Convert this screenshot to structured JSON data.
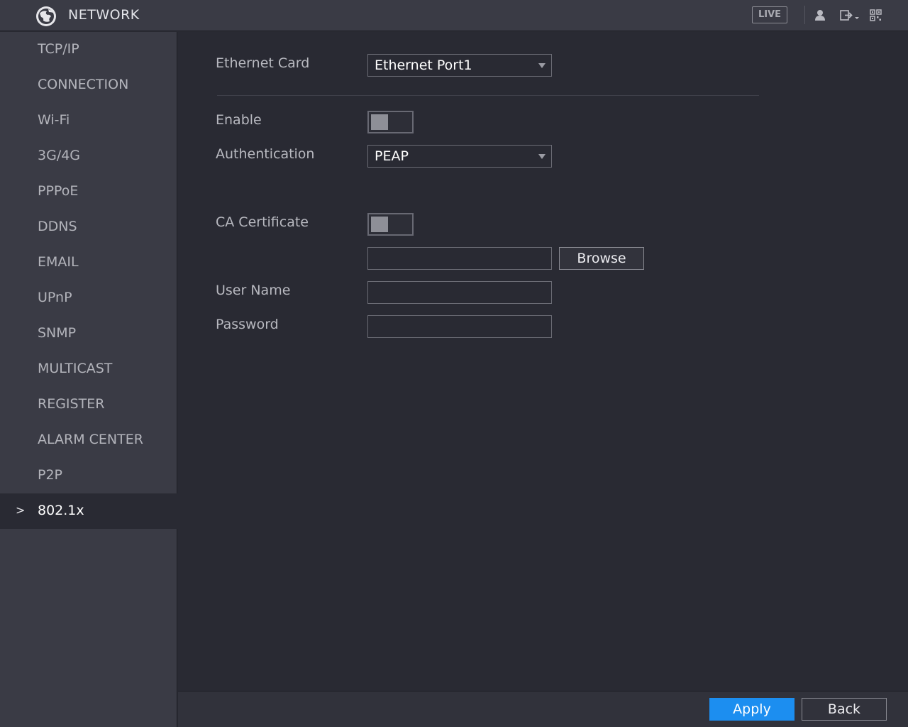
{
  "header": {
    "title": "NETWORK",
    "live_label": "LIVE",
    "icons": [
      "globe-logo",
      "user-icon",
      "logout-icon",
      "qr-code-icon"
    ]
  },
  "sidebar": {
    "items": [
      {
        "label": "TCP/IP"
      },
      {
        "label": "CONNECTION"
      },
      {
        "label": "Wi-Fi"
      },
      {
        "label": "3G/4G"
      },
      {
        "label": "PPPoE"
      },
      {
        "label": "DDNS"
      },
      {
        "label": "EMAIL"
      },
      {
        "label": "UPnP"
      },
      {
        "label": "SNMP"
      },
      {
        "label": "MULTICAST"
      },
      {
        "label": "REGISTER"
      },
      {
        "label": "ALARM CENTER"
      },
      {
        "label": "P2P"
      },
      {
        "label": "802.1x",
        "active": true
      }
    ],
    "active_chevron": ">"
  },
  "form": {
    "ethernet_card": {
      "label": "Ethernet Card",
      "value": "Ethernet Port1"
    },
    "enable": {
      "label": "Enable",
      "on": false
    },
    "authentication": {
      "label": "Authentication",
      "value": "PEAP"
    },
    "ca_certificate": {
      "label": "CA Certificate",
      "on": false
    },
    "certificate_path": {
      "value": ""
    },
    "browse_label": "Browse",
    "user_name": {
      "label": "User Name",
      "value": ""
    },
    "password": {
      "label": "Password",
      "value": ""
    }
  },
  "footer": {
    "apply_label": "Apply",
    "back_label": "Back"
  },
  "colors": {
    "accent": "#1c8ef0",
    "background": "#292a33",
    "panel": "#3a3b45"
  }
}
